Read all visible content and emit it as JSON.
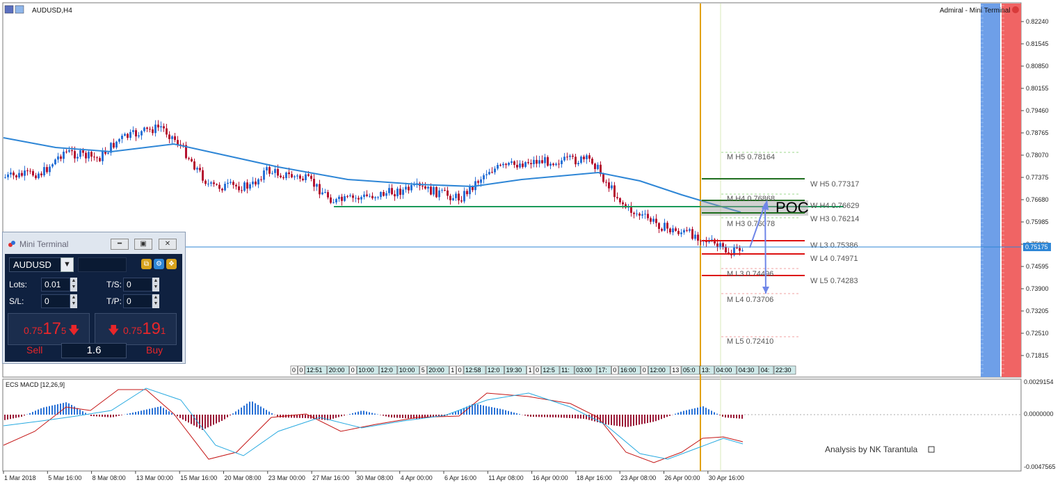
{
  "window": {
    "symbol_title": "AUDUSD,H4",
    "top_right_label": "Admiral - Mini Terminal"
  },
  "price_axis": {
    "labels": [
      "0.82240",
      "0.81545",
      "0.80850",
      "0.80155",
      "0.79460",
      "0.78765",
      "0.78070",
      "0.77375",
      "0.76680",
      "0.75985",
      "0.75290",
      "0.74595",
      "0.73900",
      "0.73205",
      "0.72510",
      "0.71815"
    ],
    "current_price": "0.75175"
  },
  "levels": {
    "weekly": [
      {
        "label": "W  H5 0.77317",
        "color": "#1f6e1f"
      },
      {
        "label": "W  H4 0.76629",
        "color": "#1f6e1f"
      },
      {
        "label": "W  H3 0.76214",
        "color": "#1f6e1f"
      },
      {
        "label": "W  L3 0.75386",
        "color": "#dd1111"
      },
      {
        "label": "W  L4 0.74971",
        "color": "#dd1111"
      },
      {
        "label": "W  L5 0.74283",
        "color": "#dd1111"
      }
    ],
    "monthly": [
      {
        "label": "M  H5 0.78164"
      },
      {
        "label": "M  H4 0.76868"
      },
      {
        "label": "M  H3 0.76078"
      },
      {
        "label": "M  L3 0.74496"
      },
      {
        "label": "M  L4 0.73706"
      },
      {
        "label": "M  L5 0.72410"
      }
    ],
    "poc_label": "POC"
  },
  "time_labels_strip": [
    "0",
    "0",
    "12:51",
    "20:00",
    "0",
    "10:00",
    "12:0",
    "10:00",
    "5",
    "20:00",
    "1",
    "0",
    "12:58",
    "12:0",
    "19:30",
    "1",
    "0",
    "12:5",
    "11:",
    "03:00",
    "17:",
    "0",
    "16:00",
    "0",
    "12:00",
    "13",
    "05:0",
    "13:",
    "04:00",
    "04:30",
    "04:",
    "22:30"
  ],
  "macd": {
    "title": "ECS MACD [12,26,9]",
    "axis_labels": [
      "0.0029154",
      "0.0000000",
      "-0.0047565"
    ],
    "credit": "Analysis by NK Tarantula"
  },
  "x_axis": {
    "labels": [
      "1 Mar 2018",
      "5 Mar 16:00",
      "8 Mar 08:00",
      "13 Mar 00:00",
      "15 Mar 16:00",
      "20 Mar 08:00",
      "23 Mar 00:00",
      "27 Mar 16:00",
      "30 Mar 08:00",
      "4 Apr 00:00",
      "6 Apr 16:00",
      "11 Apr 08:00",
      "16 Apr 00:00",
      "18 Apr 16:00",
      "23 Apr 08:00",
      "26 Apr 00:00",
      "30 Apr 16:00"
    ]
  },
  "mini_terminal": {
    "title": "Mini Terminal",
    "symbol": "AUDUSD",
    "lots_label": "Lots:",
    "lots_value": "0.01",
    "ts_label": "T/S:",
    "ts_value": "0",
    "sl_label": "S/L:",
    "sl_value": "0",
    "tp_label": "T/P:",
    "tp_value": "0",
    "sell_price_prefix": "0.75",
    "sell_price_big": "17",
    "sell_price_sup": "5",
    "buy_price_prefix": "0.75",
    "buy_price_big": "19",
    "buy_price_sup": "1",
    "sell_label": "Sell",
    "buy_label": "Buy",
    "spread": "1.6"
  },
  "colors": {
    "bull_candle": "#2a72d6",
    "bear_candle": "#b51230",
    "ma_line": "#2e86d6",
    "poc_line": "#1a9a5a",
    "vline_orange": "#e2a100",
    "macd_red": "#c41414",
    "macd_blue": "#26a9e0"
  }
}
